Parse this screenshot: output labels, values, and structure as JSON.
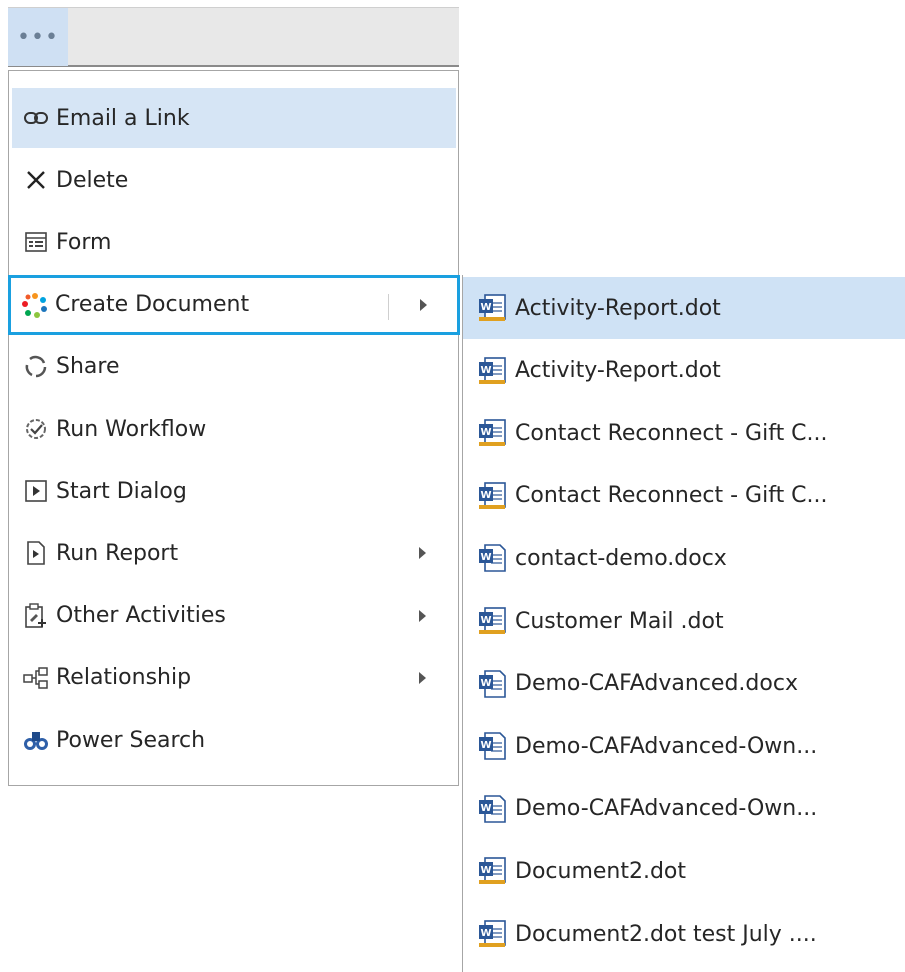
{
  "toolbar": {
    "more_label": "•••"
  },
  "menu": {
    "items": [
      {
        "label": "Email a Link",
        "icon": "link-icon",
        "has_submenu": false,
        "state": "hovered"
      },
      {
        "label": "Delete",
        "icon": "close-icon",
        "has_submenu": false,
        "state": ""
      },
      {
        "label": "Form",
        "icon": "form-icon",
        "has_submenu": false,
        "state": ""
      },
      {
        "label": "Create Document",
        "icon": "create-document-icon",
        "has_submenu": true,
        "state": "selected"
      },
      {
        "label": "Share",
        "icon": "share-icon",
        "has_submenu": false,
        "state": ""
      },
      {
        "label": "Run Workflow",
        "icon": "workflow-icon",
        "has_submenu": false,
        "state": ""
      },
      {
        "label": "Start Dialog",
        "icon": "play-box-icon",
        "has_submenu": false,
        "state": ""
      },
      {
        "label": "Run Report",
        "icon": "report-icon",
        "has_submenu": true,
        "state": ""
      },
      {
        "label": "Other Activities",
        "icon": "clipboard-add-icon",
        "has_submenu": true,
        "state": ""
      },
      {
        "label": "Relationship",
        "icon": "relationship-icon",
        "has_submenu": true,
        "state": ""
      },
      {
        "label": "Power Search",
        "icon": "binoculars-icon",
        "has_submenu": false,
        "state": ""
      }
    ]
  },
  "submenu": {
    "items": [
      {
        "label": "Activity-Report.dot",
        "icon": "word-template-icon",
        "state": "hovered"
      },
      {
        "label": "Activity-Report.dot",
        "icon": "word-template-icon",
        "state": ""
      },
      {
        "label": "Contact Reconnect - Gift C...",
        "icon": "word-template-icon",
        "state": ""
      },
      {
        "label": "Contact Reconnect - Gift C...",
        "icon": "word-template-icon",
        "state": ""
      },
      {
        "label": "contact-demo.docx",
        "icon": "word-document-icon",
        "state": ""
      },
      {
        "label": "Customer Mail .dot",
        "icon": "word-template-icon",
        "state": ""
      },
      {
        "label": "Demo-CAFAdvanced.docx",
        "icon": "word-document-icon",
        "state": ""
      },
      {
        "label": "Demo-CAFAdvanced-Own...",
        "icon": "word-document-icon",
        "state": ""
      },
      {
        "label": "Demo-CAFAdvanced-Own...",
        "icon": "word-document-icon",
        "state": ""
      },
      {
        "label": "Document2.dot",
        "icon": "word-template-icon",
        "state": ""
      },
      {
        "label": "Document2.dot test July ....",
        "icon": "word-template-icon",
        "state": ""
      }
    ]
  },
  "colors": {
    "hover": "#d6e5f5",
    "selection_border": "#1aa0e0",
    "word_blue": "#2b5797"
  }
}
